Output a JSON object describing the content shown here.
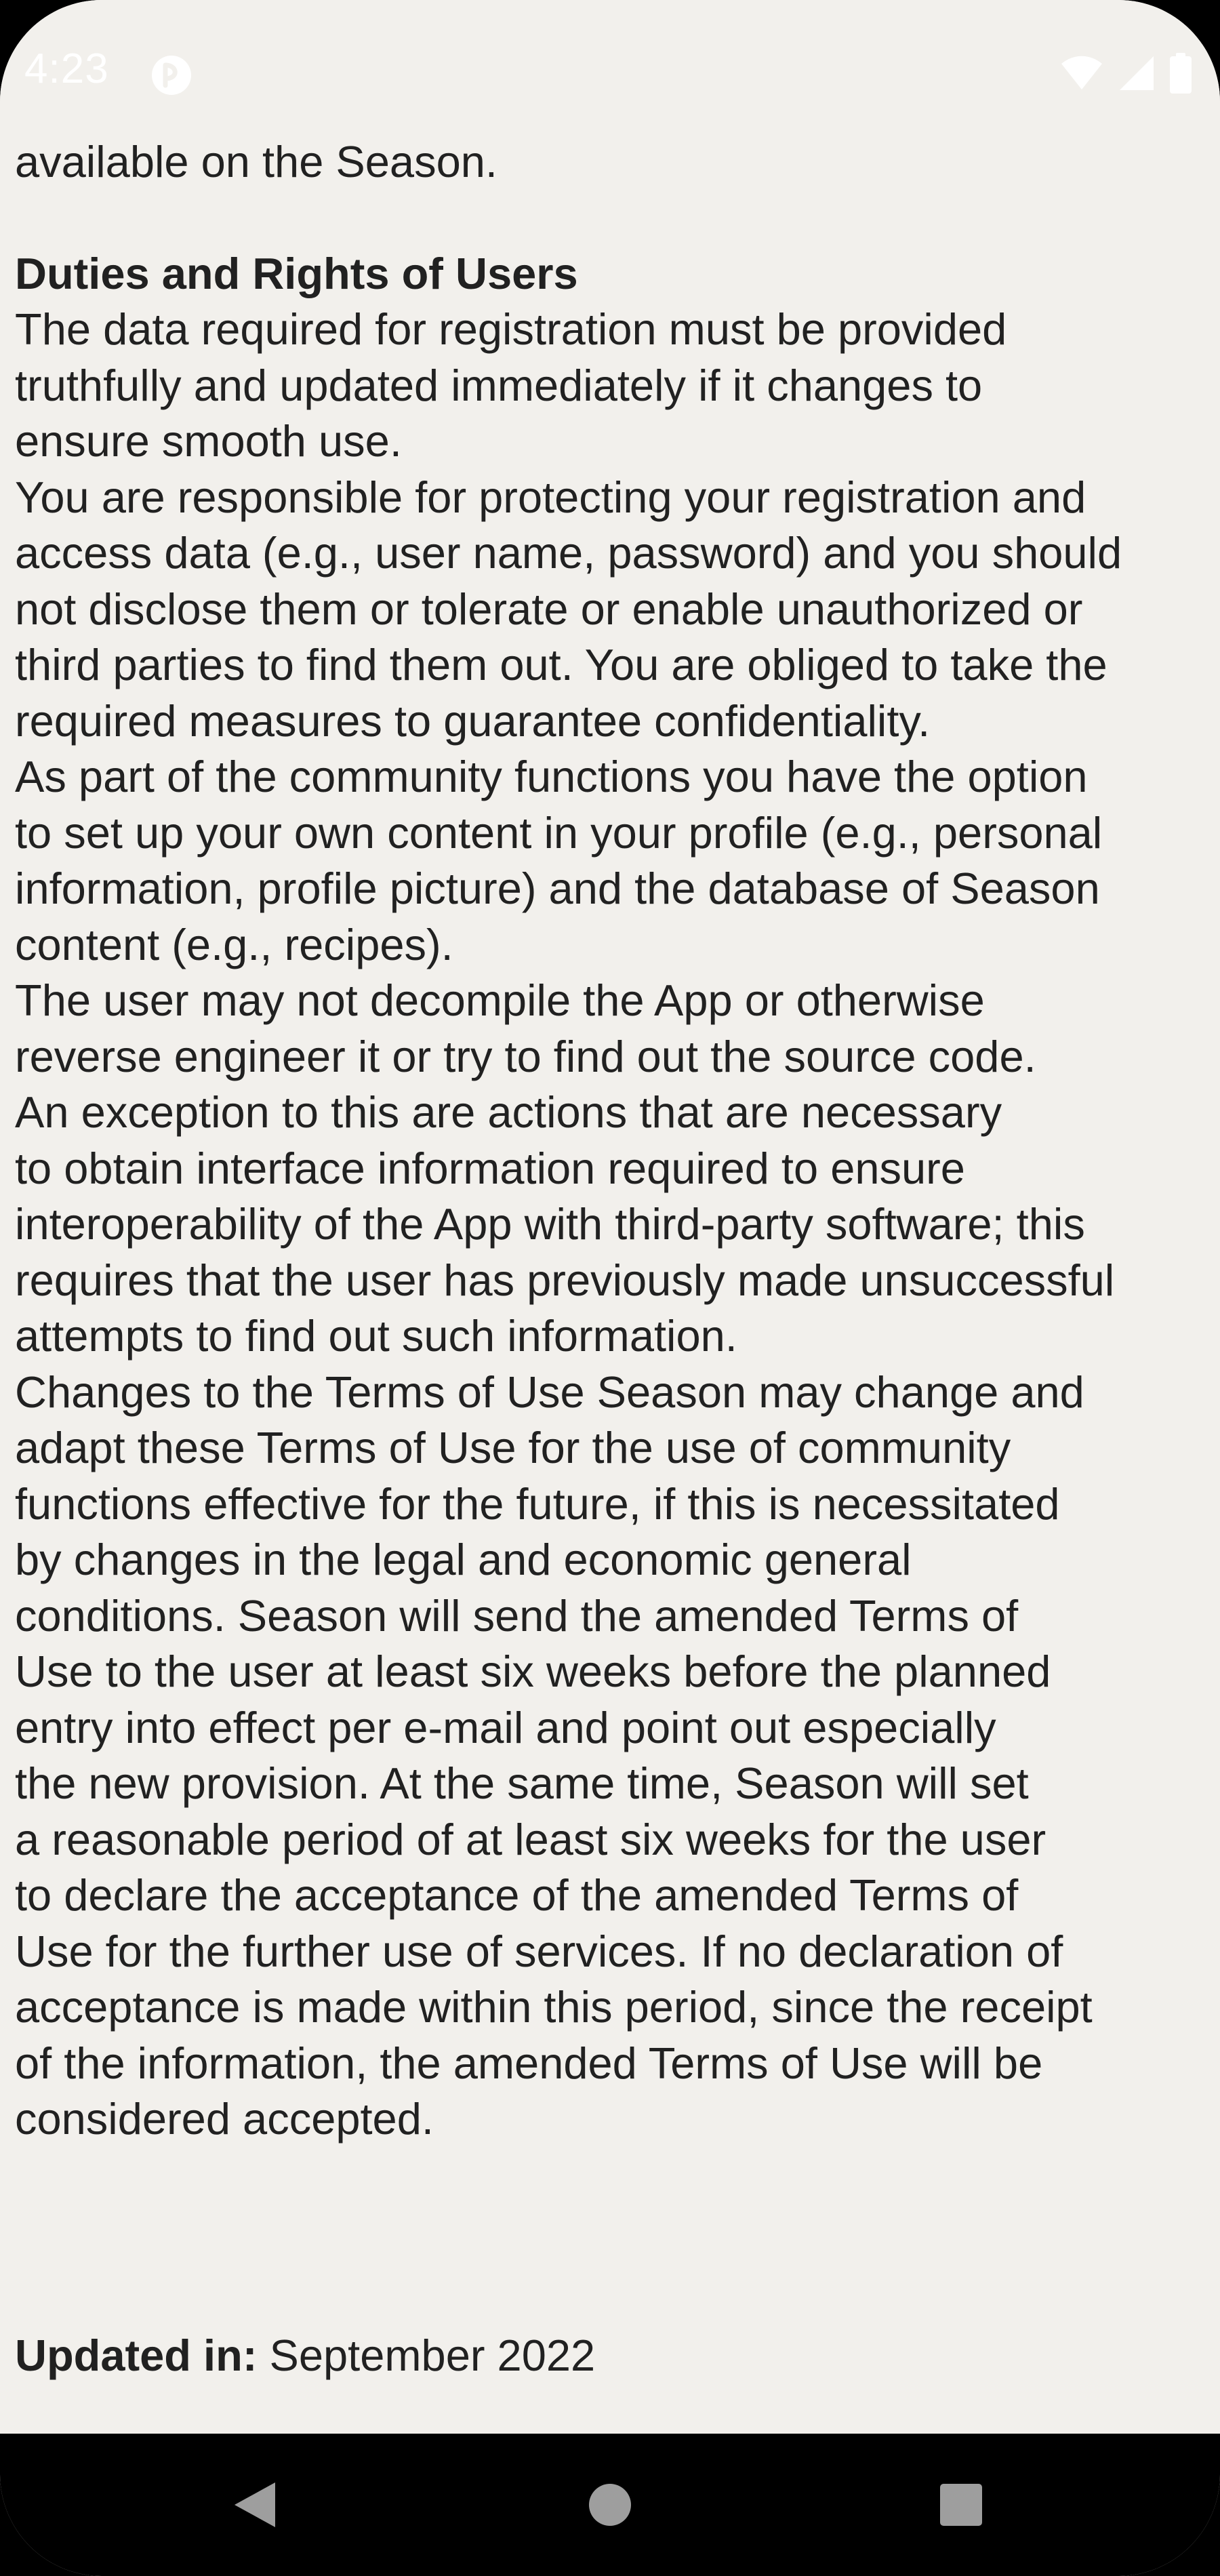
{
  "status_bar": {
    "time": "4:23",
    "app_icon": "season-app-icon",
    "icons": [
      "wifi-icon",
      "signal-icon",
      "battery-icon"
    ]
  },
  "terms": {
    "cut_off_line": "available on the Season.",
    "heading": "Duties and Rights of Users",
    "lines": [
      "The data required for registration must be provided",
      "truthfully and updated immediately if it changes to",
      "ensure smooth use.",
      "You are responsible for protecting your registration and",
      "access data (e.g., user name, password) and you should",
      "not disclose them or tolerate or enable unauthorized or",
      "third parties to find them out. You are obliged to take the",
      "required measures to guarantee confidentiality.",
      "As part of the community functions you have the option",
      "to set up your own content in your profile (e.g., personal",
      "information, profile picture) and the database of Season",
      "content (e.g., recipes).",
      "The user may not decompile the App or otherwise",
      "reverse engineer it or try to find out the source code.",
      "An exception to this are actions that are necessary",
      "to obtain interface information required to ensure",
      "interoperability of the App with third-party software; this",
      "requires that the user has previously made unsuccessful",
      "attempts to find out such information.",
      "Changes to the Terms of Use Season may change and",
      "adapt these Terms of Use for the use of community",
      "functions effective for the future, if this is necessitated",
      "by changes in the legal and economic general",
      "conditions. Season will send the amended Terms of",
      "Use to the user at least six weeks before the planned",
      "entry into effect per e-mail and point out especially",
      "the new provision. At the same time, Season will set",
      "a reasonable period of at least six weeks for the user",
      "to declare the acceptance of the amended Terms of",
      "Use for the further use of services. If no declaration of",
      "acceptance is made within this period, since the receipt",
      "of the information, the amended Terms of Use will be",
      "considered accepted."
    ],
    "updated_label": "Updated in:",
    "updated_value": "September 2022"
  },
  "nav_bar": {
    "icons": [
      "back-icon",
      "home-icon",
      "recents-icon"
    ]
  },
  "colors": {
    "background": "#f2f0ec",
    "text": "#212121",
    "nav_background": "#000000",
    "nav_icon": "#9e9e9e"
  }
}
